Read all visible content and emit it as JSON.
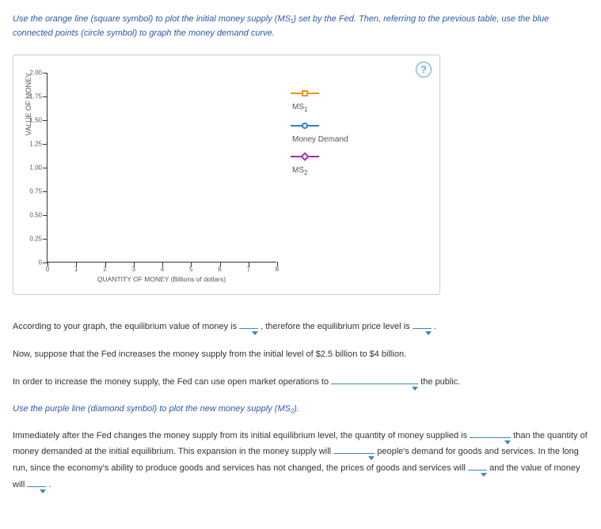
{
  "intro": "Use the orange line (square symbol) to plot the initial money supply (MS₁) set by the Fed. Then, referring to the previous table, use the blue connected points (circle symbol) to graph the money demand curve.",
  "help": "?",
  "chart_data": {
    "type": "line",
    "xlabel": "QUANTITY OF MONEY (Billions of dollars)",
    "ylabel": "VALUE OF MONEY",
    "xlim": [
      0,
      8
    ],
    "ylim": [
      0,
      2.0
    ],
    "x_ticks": [
      "0",
      "1",
      "2",
      "3",
      "4",
      "5",
      "6",
      "7",
      "8"
    ],
    "y_ticks": [
      "0",
      "0.25",
      "0.50",
      "0.75",
      "1.00",
      "1.25",
      "1.50",
      "1.75",
      "2.00"
    ],
    "series": [
      {
        "name": "MS₁",
        "symbol": "square",
        "color": "#f7931e",
        "values": []
      },
      {
        "name": "Money Demand",
        "symbol": "circle",
        "color": "#2a7fc9",
        "values": []
      },
      {
        "name": "MS₂",
        "symbol": "diamond",
        "color": "#9b2fae",
        "values": []
      }
    ]
  },
  "legend": {
    "ms1": "MS",
    "ms1_sub": "1",
    "md": "Money Demand",
    "ms2": "MS",
    "ms2_sub": "2"
  },
  "q1_a": "According to your graph, the equilibrium value of money is ",
  "q1_b": " , therefore the equilibrium price level is ",
  "q1_c": " .",
  "q2": "Now, suppose that the Fed increases the money supply from the initial level of $2.5 billion to $4 billion.",
  "q3_a": "In order to increase the money supply, the Fed can use open market operations to ",
  "q3_b": " the public.",
  "instr2": "Use the purple line (diamond symbol) to plot the new money supply (MS₂).",
  "q4_a": "Immediately after the Fed changes the money supply from its initial equilibrium level, the quantity of money supplied is ",
  "q4_b": " than the quantity of money demanded at the initial equilibrium. This expansion in the money supply will ",
  "q4_c": " people's demand for goods and services. In the long run, since the economy's ability to produce goods and services has not changed, the prices of goods and services will ",
  "q4_d": " and the value of money will ",
  "q4_e": " ."
}
